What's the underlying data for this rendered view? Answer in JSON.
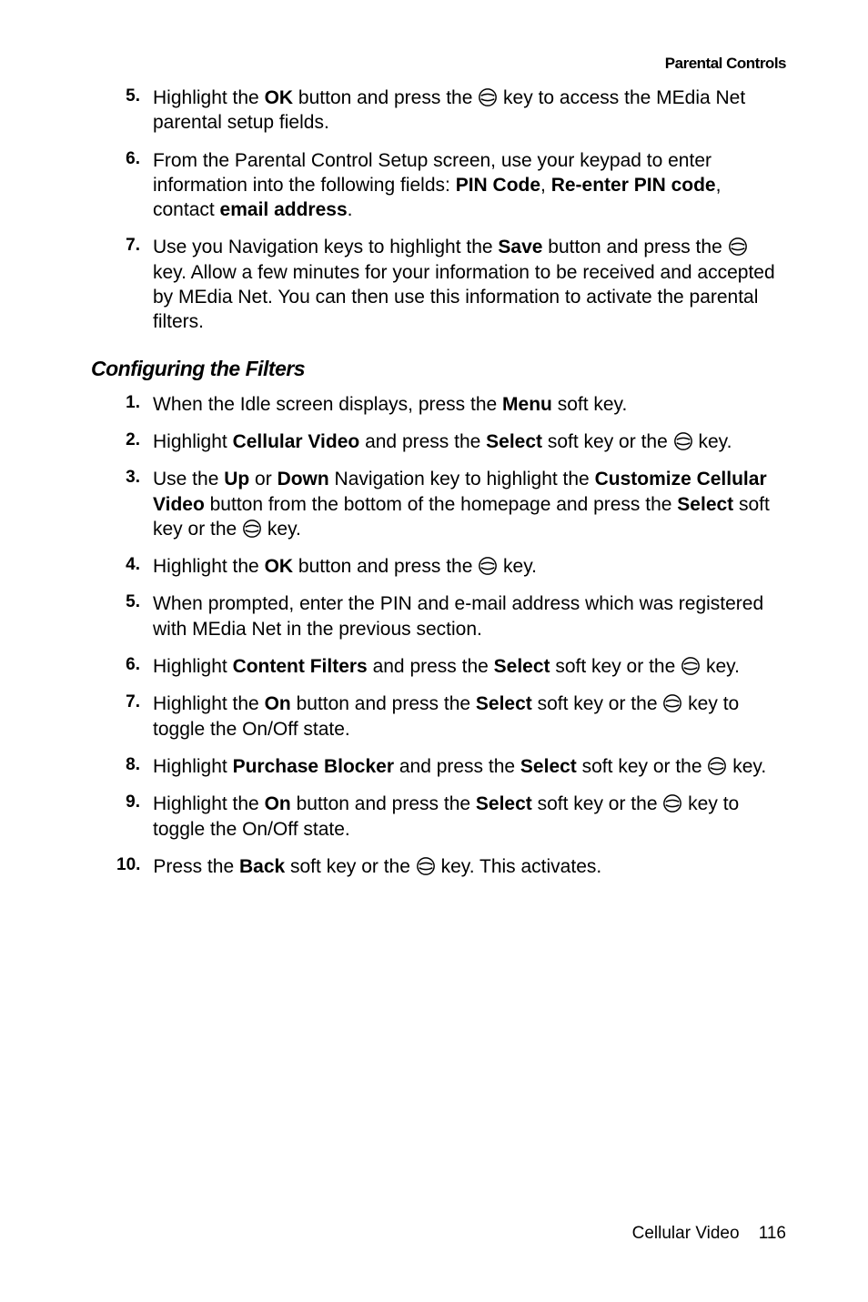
{
  "header_right": "Parental Controls",
  "section2_title": "Configuring the Filters",
  "footer_section": "Cellular Video",
  "footer_page": "116",
  "list1": [
    {
      "num": "5.",
      "segs": [
        "Highlight the ",
        {
          "b": "OK"
        },
        " button and press the ",
        {
          "icon": true
        },
        " key to access the MEdia Net parental setup fields."
      ]
    },
    {
      "num": "6.",
      "segs": [
        "From the Parental Control Setup screen, use your keypad to enter information into the following fields: ",
        {
          "b": "PIN Code"
        },
        ", ",
        {
          "b": "Re-enter PIN code"
        },
        ", contact ",
        {
          "b": "email address"
        },
        "."
      ]
    },
    {
      "num": "7.",
      "segs": [
        "Use you Navigation keys to highlight the ",
        {
          "b": "Save"
        },
        " button and press the ",
        {
          "icon": true
        },
        " key. Allow a few minutes for your information to be received and accepted by MEdia Net. You can then use this information to activate the parental filters."
      ]
    }
  ],
  "list2": [
    {
      "num": "1.",
      "segs": [
        "When the Idle screen displays, press the ",
        {
          "b": "Menu"
        },
        " soft key."
      ]
    },
    {
      "num": "2.",
      "segs": [
        "Highlight ",
        {
          "b": "Cellular Video"
        },
        " and press the ",
        {
          "b": "Select"
        },
        " soft key or the ",
        {
          "icon": true
        },
        " key."
      ]
    },
    {
      "num": "3.",
      "segs": [
        "Use the ",
        {
          "b": "Up"
        },
        " or ",
        {
          "b": "Down"
        },
        " Navigation key to highlight the ",
        {
          "b": "Customize Cellular Video"
        },
        " button from the bottom of the homepage and press the ",
        {
          "b": "Select"
        },
        " soft key or the ",
        {
          "icon": true
        },
        " key."
      ]
    },
    {
      "num": "4.",
      "segs": [
        "Highlight the ",
        {
          "b": "OK"
        },
        " button and press the ",
        {
          "icon": true
        },
        " key."
      ]
    },
    {
      "num": "5.",
      "segs": [
        "When prompted, enter the PIN and e-mail address which was registered with MEdia Net in the previous section."
      ]
    },
    {
      "num": "6.",
      "segs": [
        "Highlight ",
        {
          "b": "Content Filters"
        },
        " and press the ",
        {
          "b": "Select"
        },
        " soft key or the ",
        {
          "icon": true
        },
        " key."
      ]
    },
    {
      "num": "7.",
      "segs": [
        "Highlight the ",
        {
          "b": "On"
        },
        " button and press the ",
        {
          "b": "Select"
        },
        " soft key or the ",
        {
          "icon": true
        },
        " key to toggle the On/Off state."
      ]
    },
    {
      "num": "8.",
      "segs": [
        "Highlight ",
        {
          "b": "Purchase Blocker"
        },
        " and press the ",
        {
          "b": "Select"
        },
        " soft key or the ",
        {
          "icon": true
        },
        " key."
      ]
    },
    {
      "num": "9.",
      "segs": [
        "Highlight the ",
        {
          "b": "On"
        },
        " button and press the ",
        {
          "b": "Select"
        },
        " soft key or the ",
        {
          "icon": true
        },
        " key to toggle the On/Off state."
      ]
    },
    {
      "num": "10.",
      "segs": [
        "Press the ",
        {
          "b": "Back"
        },
        " soft key or the ",
        {
          "icon": true
        },
        " key. This activates."
      ]
    }
  ]
}
